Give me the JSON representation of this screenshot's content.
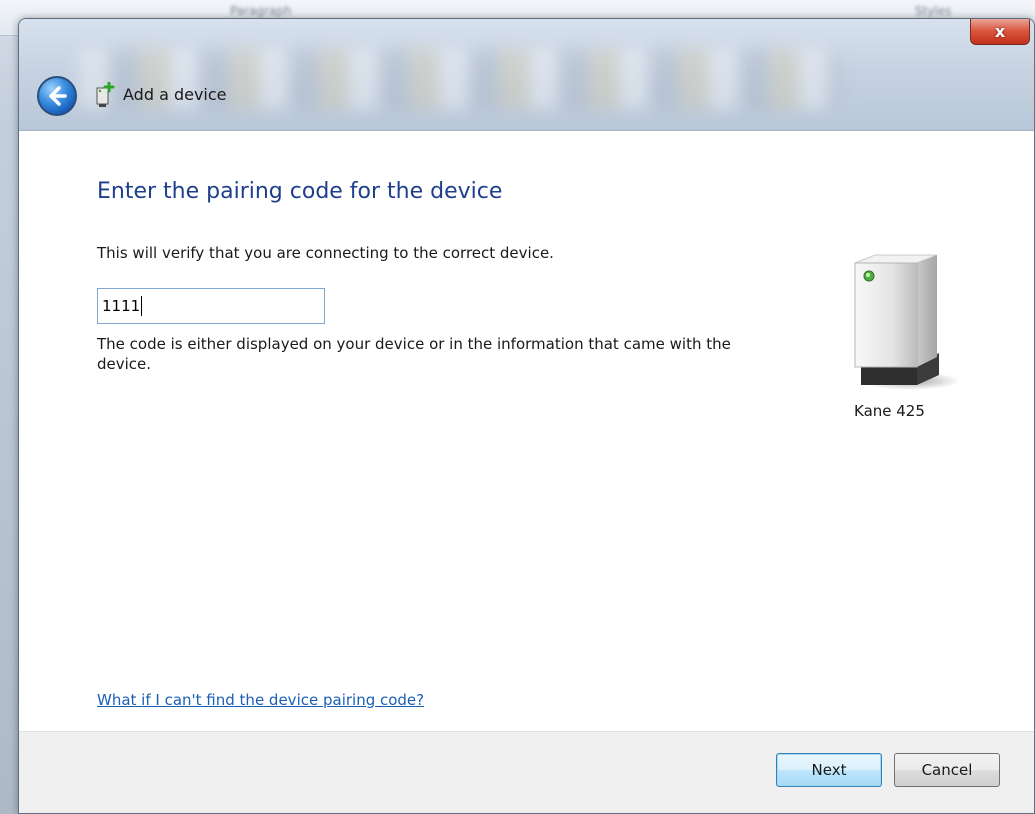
{
  "background_app": {
    "ribbon_group_label": "Paragraph",
    "ribbon_group_label_2": "Styles"
  },
  "window": {
    "title": "Add a device",
    "close_symbol": "x"
  },
  "content": {
    "heading": "Enter the pairing code for the device",
    "subtext": "This will verify that you are connecting to the correct device.",
    "code_value": "1111",
    "help_text": "The code is either displayed on your device or in the information that came with the device.",
    "device_name": "Kane 425",
    "help_link": "What if I can't find the device pairing code?"
  },
  "footer": {
    "next_label": "Next",
    "cancel_label": "Cancel"
  },
  "icons": {
    "back": "back-arrow-icon",
    "small_device": "add-device-icon",
    "big_device": "device-icon"
  },
  "colors": {
    "heading": "#1e3f8c",
    "link": "#1b5fb5",
    "close_button": "#d9533b",
    "next_button_border": "#3c7fb1"
  }
}
